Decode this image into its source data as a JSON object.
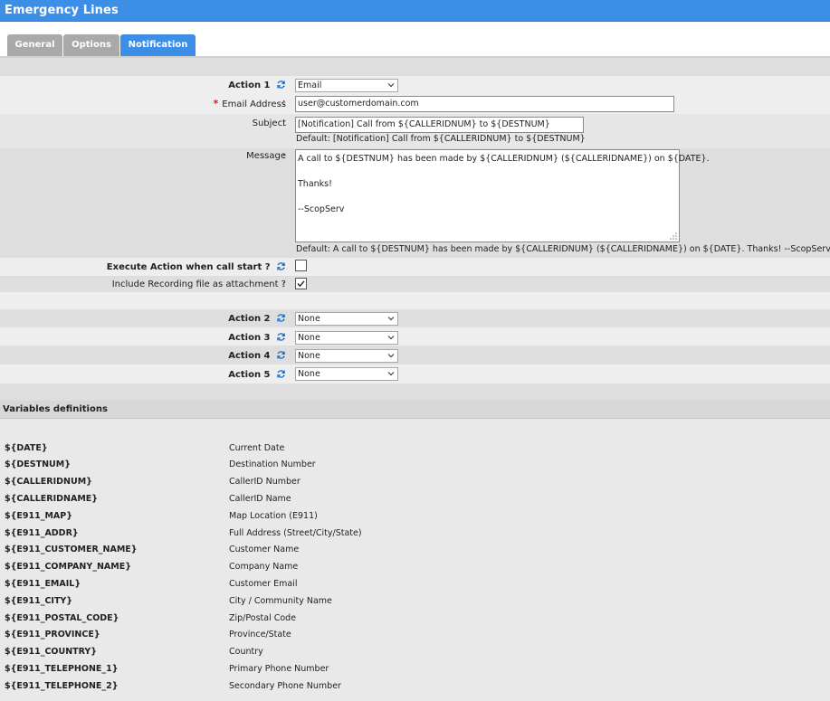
{
  "window": {
    "title": "Emergency Lines"
  },
  "tabs": [
    {
      "label": "General",
      "active": false
    },
    {
      "label": "Options",
      "active": false
    },
    {
      "label": "Notification",
      "active": true
    }
  ],
  "colors": {
    "accent": "#3c8ee6",
    "required": "#d0202a",
    "tab_inactive": "#a9a9a9"
  },
  "form": {
    "colon": ":",
    "action1": {
      "label": "Action 1",
      "value": "Email",
      "icon": "refresh-icon"
    },
    "email": {
      "required_mark": "*",
      "label": "Email Address",
      "value": "user@customerdomain.com"
    },
    "subject": {
      "label": "Subject",
      "value": "[Notification] Call from ${CALLERIDNUM} to ${DESTNUM}",
      "default": "Default: [Notification] Call from ${CALLERIDNUM} to ${DESTNUM}"
    },
    "message": {
      "label": "Message",
      "lines": [
        "A call to ${DESTNUM} has been made by ${CALLERIDNUM} (${CALLERIDNAME}) on ${DATE}.",
        "",
        "Thanks!",
        "",
        "--ScopServ"
      ],
      "default": "Default: A call to ${DESTNUM} has been made by ${CALLERIDNUM} (${CALLERIDNAME}) on ${DATE}. Thanks! --ScopServ"
    },
    "execute_on_start": {
      "label": "Execute Action when call start ?",
      "checked": false
    },
    "include_recording": {
      "label": "Include Recording file as attachment ?",
      "checked": true
    },
    "action2": {
      "label": "Action 2",
      "value": "None"
    },
    "action3": {
      "label": "Action 3",
      "value": "None"
    },
    "action4": {
      "label": "Action 4",
      "value": "None"
    },
    "action5": {
      "label": "Action 5",
      "value": "None"
    }
  },
  "variables": {
    "title": "Variables definitions",
    "rows": [
      {
        "name": "${DATE}",
        "desc": "Current Date"
      },
      {
        "name": "${DESTNUM}",
        "desc": "Destination Number"
      },
      {
        "name": "${CALLERIDNUM}",
        "desc": "CallerID Number"
      },
      {
        "name": "${CALLERIDNAME}",
        "desc": "CallerID Name"
      },
      {
        "name": "${E911_MAP}",
        "desc": "Map Location (E911)"
      },
      {
        "name": "${E911_ADDR}",
        "desc": "Full Address (Street/City/State)"
      },
      {
        "name": "${E911_CUSTOMER_NAME}",
        "desc": "Customer Name"
      },
      {
        "name": "${E911_COMPANY_NAME}",
        "desc": "Company Name"
      },
      {
        "name": "${E911_EMAIL}",
        "desc": "Customer Email"
      },
      {
        "name": "${E911_CITY}",
        "desc": "City / Community Name"
      },
      {
        "name": "${E911_POSTAL_CODE}",
        "desc": "Zip/Postal Code"
      },
      {
        "name": "${E911_PROVINCE}",
        "desc": "Province/State"
      },
      {
        "name": "${E911_COUNTRY}",
        "desc": "Country"
      },
      {
        "name": "${E911_TELEPHONE_1}",
        "desc": "Primary Phone Number"
      },
      {
        "name": "${E911_TELEPHONE_2}",
        "desc": "Secondary Phone Number"
      }
    ]
  }
}
